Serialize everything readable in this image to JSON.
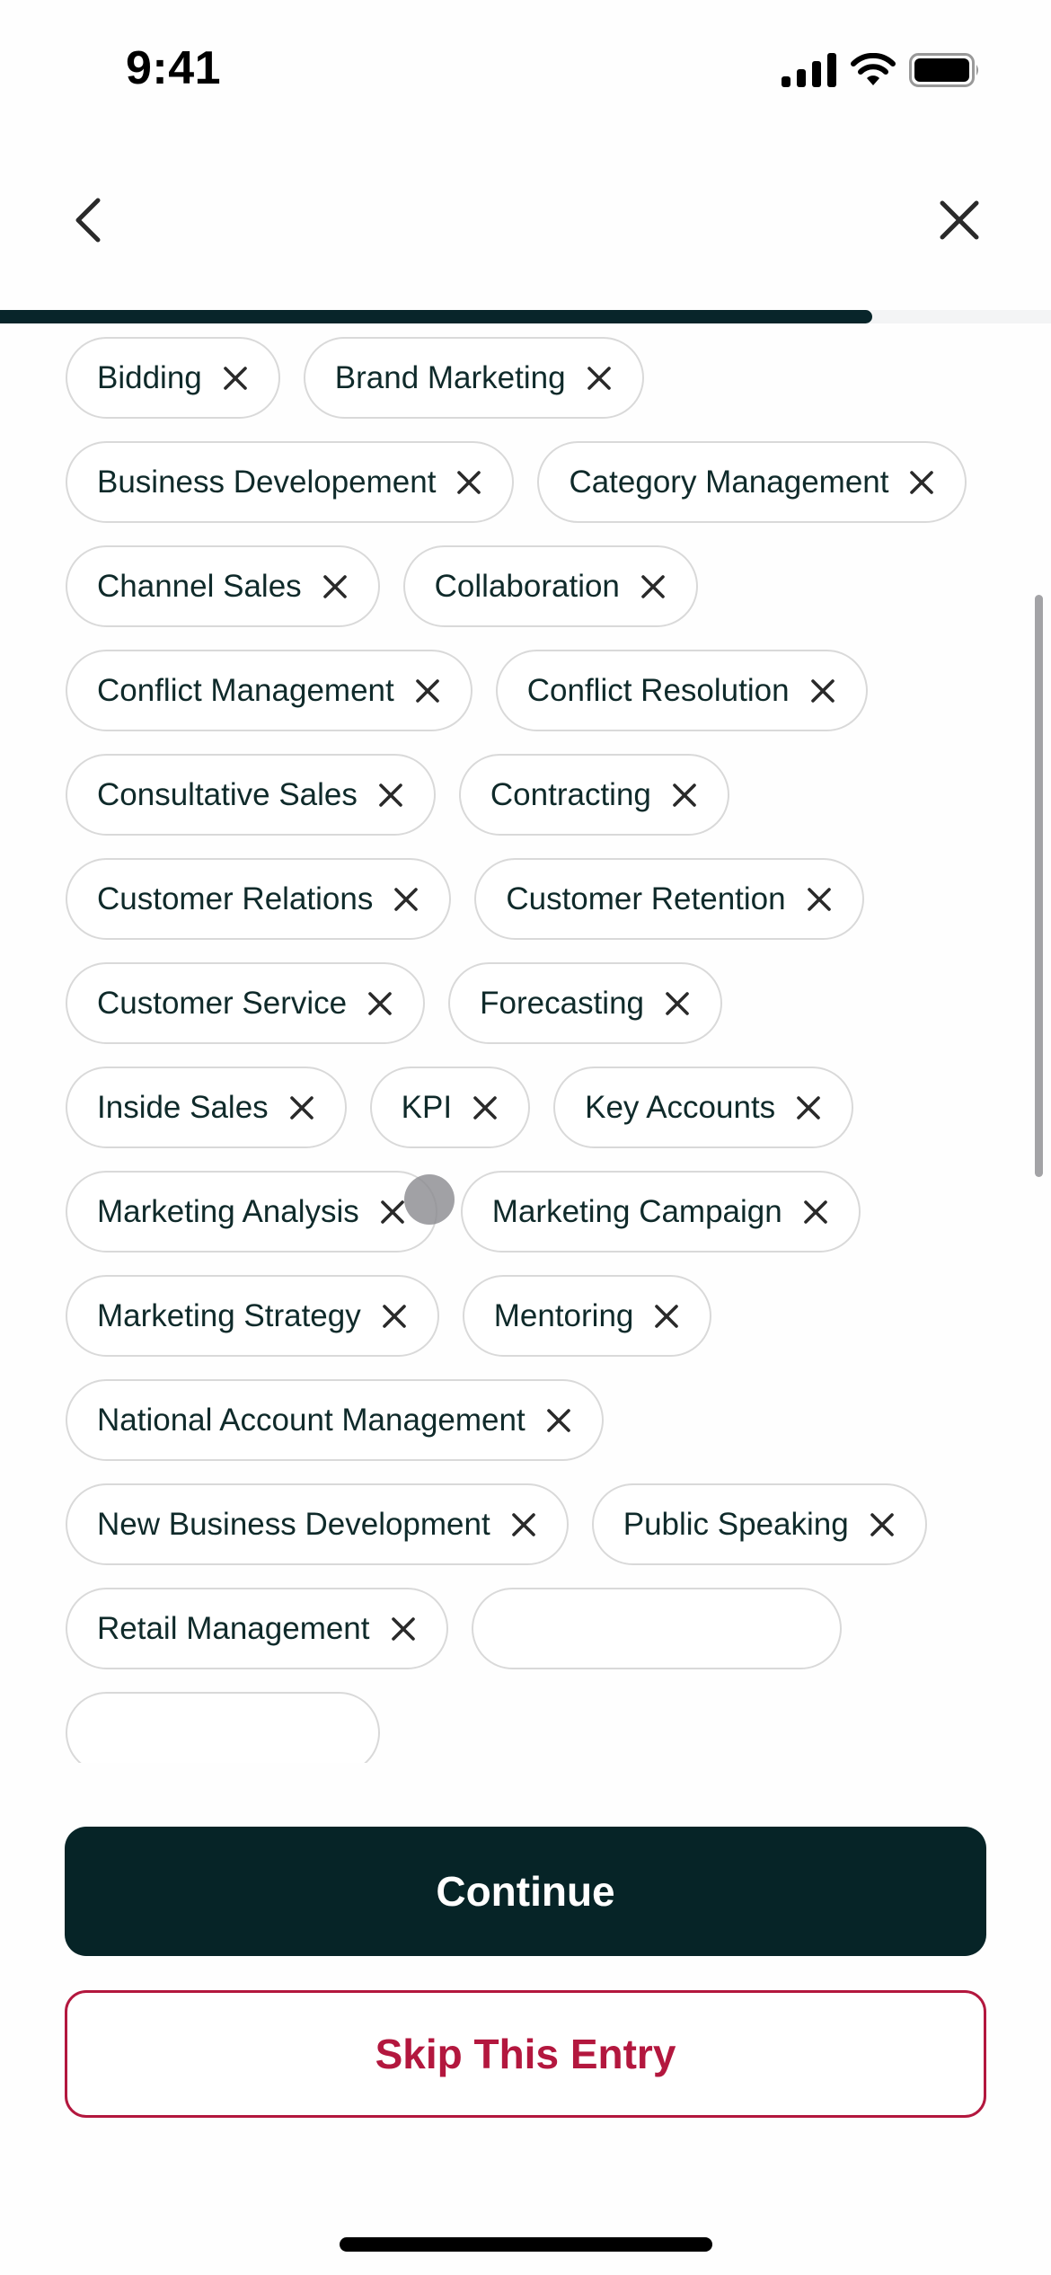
{
  "status_bar": {
    "time": "9:41",
    "signal_icon": "cellular-signal-icon",
    "wifi_icon": "wifi-icon",
    "battery_icon": "battery-icon"
  },
  "nav": {
    "back_icon": "chevron-left-icon",
    "close_icon": "close-icon"
  },
  "progress": {
    "value_percent": 83,
    "fill_color": "#08252a",
    "track_color": "#f3f4f5"
  },
  "chips": [
    "Bidding",
    "Brand Marketing",
    "Business Developement",
    "Category Management",
    "Channel Sales",
    "Collaboration",
    "Conflict Management",
    "Conflict Resolution",
    "Consultative Sales",
    "Contracting",
    "Customer Relations",
    "Customer Retention",
    "Customer Service",
    "Forecasting",
    "Inside Sales",
    "KPI",
    "Key Accounts",
    "Marketing Analysis",
    "Marketing Campaign",
    "Marketing Strategy",
    "Mentoring",
    "National Account Management",
    "New Business Development",
    "Public Speaking",
    "Retail Management"
  ],
  "chip_remove_icon": "close-icon",
  "actions": {
    "continue_label": "Continue",
    "skip_label": "Skip This Entry"
  },
  "colors": {
    "primary": "#062427",
    "danger": "#b3173e",
    "chip_border": "#d9d9d9",
    "text": "#0f2a2a"
  }
}
